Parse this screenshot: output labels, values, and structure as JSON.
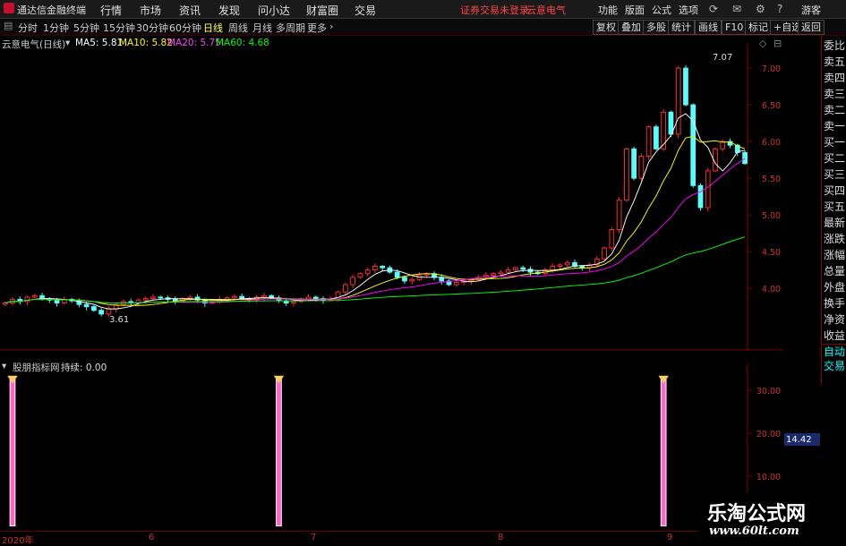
{
  "menubar": {
    "app_title": "通达信金融终端",
    "items": [
      "行情",
      "市场",
      "资讯",
      "发现",
      "问小达",
      "财富圈",
      "交易"
    ],
    "status_login": "证券交易未登录",
    "status_stock": "云意电气",
    "right_items": [
      "功能",
      "版面",
      "公式",
      "选项"
    ],
    "guest": "游客"
  },
  "periodbar": {
    "periods": [
      "分时",
      "1分钟",
      "5分钟",
      "15分钟",
      "30分钟",
      "60分钟",
      "日线",
      "周线",
      "月线",
      "多周期",
      "更多"
    ],
    "active_period": "日线",
    "tools": [
      "复权",
      "叠加",
      "多股",
      "统计",
      "画线",
      "F10",
      "标记",
      "+自选",
      "返回"
    ]
  },
  "main_chart": {
    "stock_title": "云意电气(日线)",
    "ma": [
      {
        "label": "MA5: 5.81",
        "color": "#ffffff"
      },
      {
        "label": "MA10: 5.82",
        "color": "#ffff00"
      },
      {
        "label": "MA20: 5.75",
        "color": "#ff00ff"
      },
      {
        "label": "MA60: 4.68",
        "color": "#00ff00"
      }
    ],
    "high_label": "7.07",
    "low_label": "3.61"
  },
  "sub_chart": {
    "indicator_title": "股朋指标网",
    "indicator_value": "持续: 0.00",
    "current_value": "14.42"
  },
  "right_panel": {
    "items": [
      "委比",
      "卖五",
      "卖四",
      "卖三",
      "卖二",
      "卖一",
      "买一",
      "买二",
      "买三",
      "买四",
      "买五",
      "最新",
      "涨跌",
      "涨幅",
      "总量",
      "外盘",
      "换手",
      "净资",
      "收益"
    ],
    "auto_trade": [
      "自动",
      "交易"
    ]
  },
  "x_axis": {
    "labels": [
      "2020年",
      "6",
      "7",
      "8",
      "9"
    ]
  },
  "watermark": {
    "title": "乐淘公式网",
    "url": "www.60lt.com"
  },
  "chart_data": [
    {
      "type": "candlestick",
      "title": "云意电气(日线)",
      "y_ticks": [
        "7.00",
        "6.50",
        "6.00",
        "5.50",
        "5.00",
        "4.50",
        "4.00"
      ],
      "ylim": [
        3.5,
        7.2
      ],
      "closes": [
        3.8,
        3.85,
        3.82,
        3.88,
        3.9,
        3.86,
        3.84,
        3.8,
        3.85,
        3.83,
        3.78,
        3.75,
        3.7,
        3.65,
        3.72,
        3.78,
        3.82,
        3.8,
        3.84,
        3.86,
        3.88,
        3.87,
        3.85,
        3.83,
        3.86,
        3.88,
        3.84,
        3.8,
        3.82,
        3.85,
        3.87,
        3.89,
        3.86,
        3.84,
        3.88,
        3.9,
        3.87,
        3.83,
        3.8,
        3.82,
        3.85,
        3.88,
        3.86,
        3.84,
        3.85,
        3.95,
        4.05,
        4.15,
        4.2,
        4.25,
        4.3,
        4.28,
        4.22,
        4.15,
        4.1,
        4.12,
        4.18,
        4.2,
        4.15,
        4.1,
        4.05,
        4.08,
        4.1,
        4.12,
        4.15,
        4.18,
        4.2,
        4.22,
        4.25,
        4.28,
        4.26,
        4.22,
        4.2,
        4.25,
        4.3,
        4.32,
        4.35,
        4.3,
        4.28,
        4.32,
        4.4,
        4.55,
        4.8,
        5.2,
        5.9,
        5.5,
        5.8,
        6.2,
        5.9,
        6.4,
        6.1,
        7.0,
        6.5,
        5.4,
        5.1,
        5.6,
        5.9,
        6.0,
        5.95,
        5.85,
        5.7
      ],
      "ma_series": [
        "MA5",
        "MA10",
        "MA20",
        "MA60"
      ]
    },
    {
      "type": "bar",
      "title": "股朋指标网",
      "y_ticks": [
        "30.00",
        "20.00",
        "10.00"
      ],
      "ylim": [
        0,
        35
      ],
      "signal_positions": [
        1,
        37,
        89
      ],
      "signal_value": 33
    }
  ]
}
